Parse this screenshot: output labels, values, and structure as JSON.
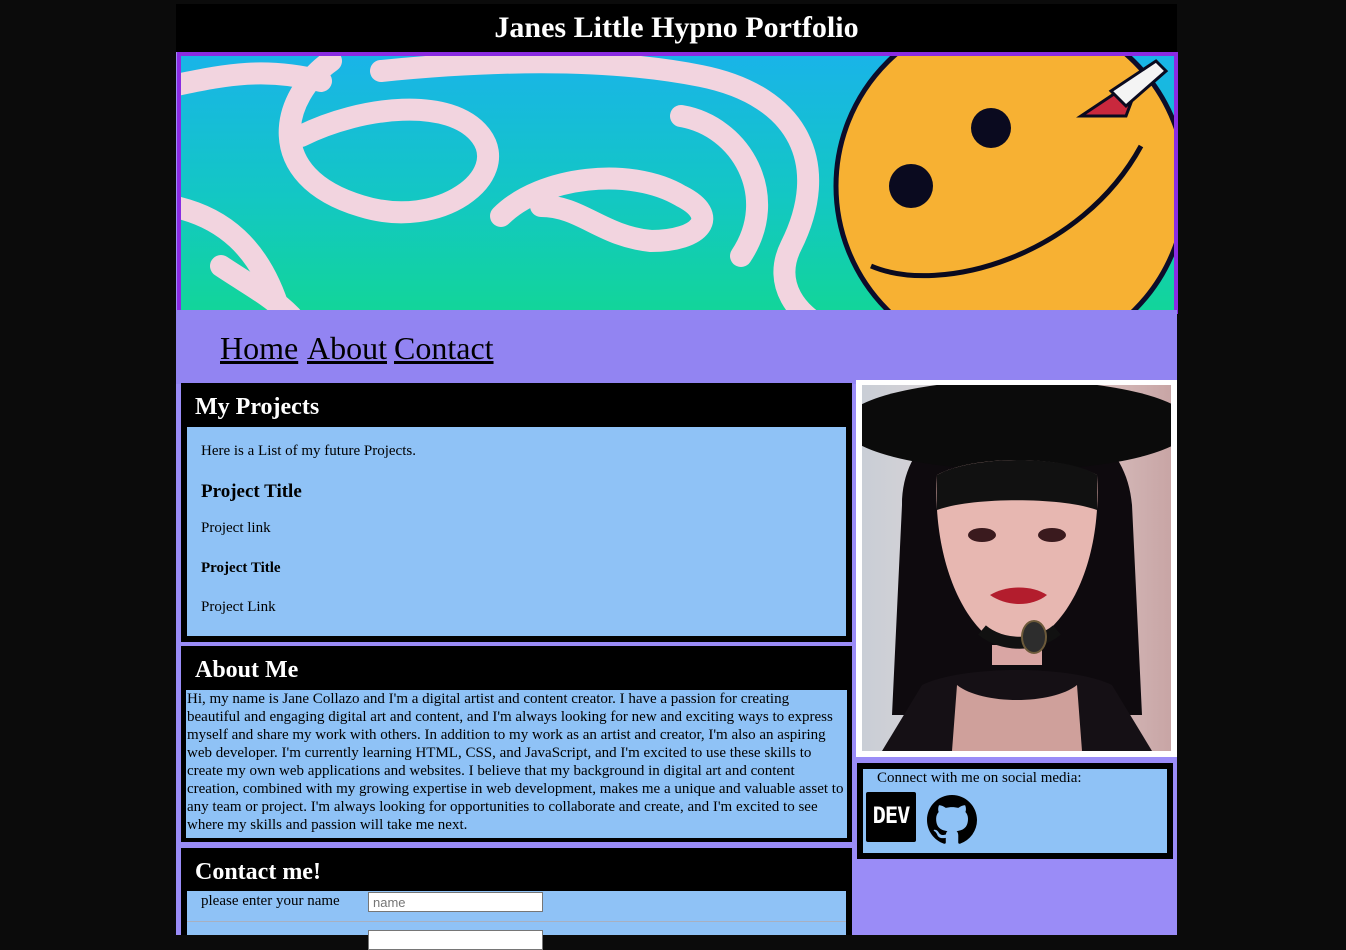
{
  "site": {
    "title": "Janes Little Hypno Portfolio"
  },
  "nav": {
    "home": "Home",
    "about": "About",
    "contact": "Contact"
  },
  "projects": {
    "heading": "My Projects",
    "intro": "Here is a List of my future Projects.",
    "items": [
      {
        "title": "Project Title",
        "link": "Project link"
      },
      {
        "title": "Project Title",
        "link": "Project Link"
      }
    ]
  },
  "about": {
    "heading": "About Me",
    "text": "Hi, my name is Jane Collazo and I'm a digital artist and content creator. I have a passion for creating beautiful and engaging digital art and content, and I'm always looking for new and exciting ways to express myself and share my work with others. In addition to my work as an artist and creator, I'm also an aspiring web developer. I'm currently learning HTML, CSS, and JavaScript, and I'm excited to use these skills to create my own web applications and websites. I believe that my background in digital art and content creation, combined with my growing expertise in web development, makes me a unique and valuable asset to any team or project. I'm always looking for opportunities to collaborate and create, and I'm excited to see where my skills and passion will take me next."
  },
  "contact": {
    "heading": "Contact me!",
    "name_label": "please enter your name",
    "name_placeholder": "name"
  },
  "social": {
    "caption": "Connect with me on social media:",
    "dev_label": "DEV",
    "icons": [
      "dev-icon",
      "github-icon"
    ]
  },
  "colors": {
    "page_bg": "#9a8cf7",
    "nav_bg": "#9284f2",
    "panel_bg": "#8fc2f6",
    "header_bg": "#000000",
    "banner_border": "#8a2be2"
  }
}
